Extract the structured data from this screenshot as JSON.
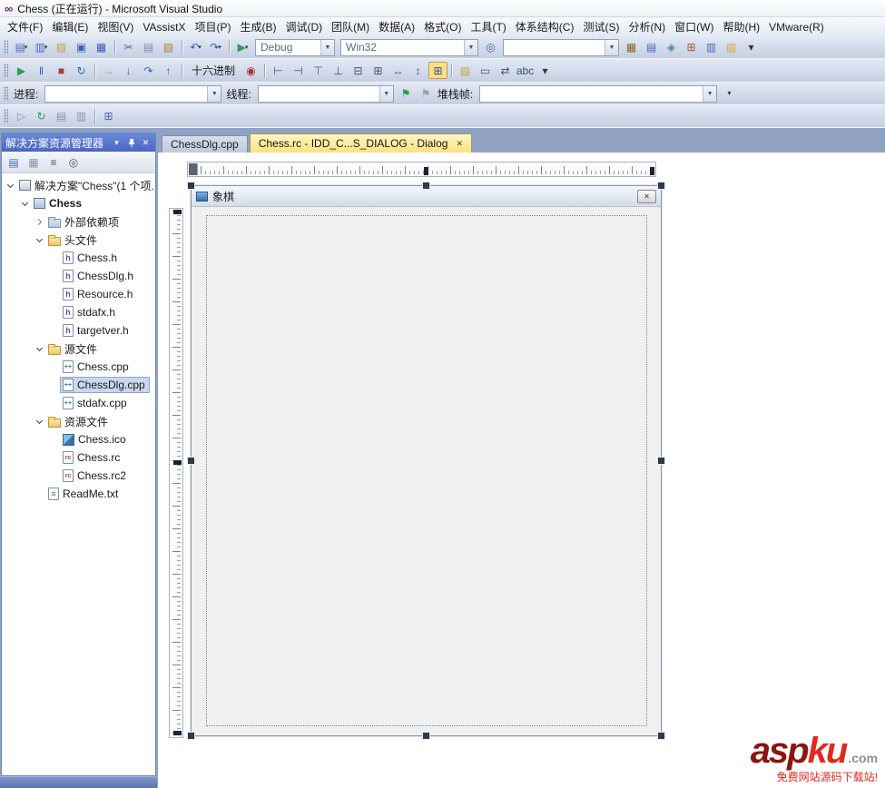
{
  "window": {
    "title": "Chess (正在运行) - Microsoft Visual Studio"
  },
  "menu": {
    "items": [
      "文件(F)",
      "编辑(E)",
      "视图(V)",
      "VAssistX",
      "项目(P)",
      "生成(B)",
      "调试(D)",
      "团队(M)",
      "数据(A)",
      "格式(O)",
      "工具(T)",
      "体系结构(C)",
      "测试(S)",
      "分析(N)",
      "窗口(W)",
      "帮助(H)",
      "VMware(R)"
    ]
  },
  "toolbar_standard": {
    "left_icons": [
      {
        "n": "new-project-icon",
        "g": "▤",
        "c": "#4a68b8",
        "caret": true
      },
      {
        "n": "add-item-icon",
        "g": "▥",
        "c": "#4a68b8",
        "caret": true
      },
      {
        "n": "open-file-icon",
        "g": "▨",
        "c": "#c9a23a"
      },
      {
        "n": "save-icon",
        "g": "▣",
        "c": "#3a62b8"
      },
      {
        "n": "save-all-icon",
        "g": "▦",
        "c": "#3a62b8"
      },
      {
        "sep": true
      },
      {
        "n": "cut-icon",
        "g": "✂",
        "c": "#5a6678"
      },
      {
        "n": "copy-icon",
        "g": "▤",
        "c": "#808ca0"
      },
      {
        "n": "paste-icon",
        "g": "▧",
        "c": "#b08030"
      },
      {
        "sep": true
      },
      {
        "n": "undo-icon",
        "g": "↶",
        "c": "#2f5bd0",
        "caret": true
      },
      {
        "n": "redo-icon",
        "g": "↷",
        "c": "#2f5bd0",
        "caret": true
      },
      {
        "sep": true
      },
      {
        "n": "start-debugging-icon",
        "g": "▶",
        "c": "#2e9e4f",
        "caret": true
      }
    ],
    "config_value": "Debug",
    "platform_value": "Win32",
    "mid_icons": [
      {
        "n": "find-in-files-icon",
        "g": "◎",
        "c": "#4a68b8"
      }
    ],
    "search_value": "",
    "right_icons": [
      {
        "n": "solution-explorer-icon",
        "g": "▦",
        "c": "#8a6a2a"
      },
      {
        "n": "properties-window-icon",
        "g": "▤",
        "c": "#4a68b8"
      },
      {
        "n": "object-browser-icon",
        "g": "◈",
        "c": "#3a8aa0"
      },
      {
        "n": "toolbox-icon",
        "g": "⊞",
        "c": "#a05a3a"
      },
      {
        "n": "command-window-icon",
        "g": "▥",
        "c": "#4a68b8"
      },
      {
        "n": "extension-icon",
        "g": "▨",
        "c": "#D8A838"
      },
      {
        "n": "toolbar-options-icon",
        "g": "▾",
        "c": "#333"
      }
    ]
  },
  "toolbar_debug": {
    "items": [
      {
        "n": "continue-icon",
        "g": "▶",
        "c": "#2e9e4f"
      },
      {
        "n": "break-all-icon",
        "g": "‖",
        "c": "#2e5ebf"
      },
      {
        "n": "stop-debugging-icon",
        "g": "■",
        "c": "#b03a3a"
      },
      {
        "n": "restart-icon",
        "g": "↻",
        "c": "#2e5ebf"
      },
      {
        "sep": true
      },
      {
        "n": "show-next-statement-icon",
        "g": "→",
        "c": "#c9a21a"
      },
      {
        "n": "step-into-icon",
        "g": "↓",
        "c": "#2e5ebf"
      },
      {
        "n": "step-over-icon",
        "g": "↷",
        "c": "#2e5ebf"
      },
      {
        "n": "step-out-icon",
        "g": "↑",
        "c": "#2e5ebf"
      },
      {
        "sep": true
      },
      {
        "btn": "十六进制",
        "n": "hex-display-button"
      },
      {
        "n": "breakpoints-window-icon",
        "g": "◉",
        "c": "#a33333"
      },
      {
        "sep": true
      },
      {
        "n": "align-lefts-icon",
        "g": "⊢",
        "c": "#4a5568"
      },
      {
        "n": "align-rights-icon",
        "g": "⊣",
        "c": "#4a5568"
      },
      {
        "n": "align-tops-icon",
        "g": "⊤",
        "c": "#4a5568"
      },
      {
        "n": "align-bottoms-icon",
        "g": "⊥",
        "c": "#4a5568"
      },
      {
        "n": "center-horizontal-icon",
        "g": "⊟",
        "c": "#4a5568"
      },
      {
        "n": "center-vertical-icon",
        "g": "⊞",
        "c": "#4a5568"
      },
      {
        "n": "make-same-width-icon",
        "g": "↔",
        "c": "#4a5568"
      },
      {
        "n": "make-same-height-icon",
        "g": "↕",
        "c": "#4a5568"
      },
      {
        "n": "toggle-grid-icon",
        "g": "⊞",
        "c": "#35507a",
        "hl": true
      },
      {
        "sep": true
      },
      {
        "n": "new-folder-icon",
        "g": "▨",
        "c": "#c9a23a"
      },
      {
        "n": "test-dialog-icon",
        "g": "▭",
        "c": "#4a5568"
      },
      {
        "n": "tab-order-icon",
        "g": "⇄",
        "c": "#4a5568"
      },
      {
        "n": "spell-check-icon",
        "g": "abc",
        "c": "#35507a"
      },
      {
        "n": "toolbar-options-icon",
        "g": "▾",
        "c": "#333"
      }
    ]
  },
  "debug_location": {
    "process_label": "进程:",
    "process_value": "",
    "thread_label": "线程:",
    "thread_value": "",
    "flags": [
      {
        "n": "show-threads-flag-icon",
        "g": "⚑",
        "c": "#2e9e4f"
      },
      {
        "n": "flag-threads-icon",
        "g": "⚑",
        "c": "#97a2b4"
      }
    ],
    "stack_label": "堆栈帧:",
    "stack_value": ""
  },
  "toolbar_misc": {
    "items": [
      {
        "n": "browse-forward-icon",
        "g": "▷",
        "c": "#8a94a8"
      },
      {
        "n": "refresh-icon",
        "g": "↻",
        "c": "#2e9e4f"
      },
      {
        "n": "copy-icon-2",
        "g": "▤",
        "c": "#8a94a8"
      },
      {
        "n": "pages-icon",
        "g": "▥",
        "c": "#8a94a8"
      },
      {
        "sep": true
      },
      {
        "n": "window-layout-icon",
        "g": "⊞",
        "c": "#4a68b8"
      }
    ]
  },
  "solution_explorer": {
    "title": "解决方案资源管理器",
    "toolbar_icons": [
      {
        "n": "properties-icon",
        "g": "▤",
        "c": "#4a68b8"
      },
      {
        "n": "show-all-files-icon",
        "g": "▦",
        "c": "#8a94a8"
      },
      {
        "n": "view-code-icon",
        "g": "≡",
        "c": "#4a5568"
      },
      {
        "n": "search-icon",
        "g": "◎",
        "c": "#4a5568"
      }
    ],
    "tree": [
      {
        "label": "解决方案\"Chess\"(1 个项...",
        "indent": 0,
        "icon": "solution",
        "arrow": "expanded"
      },
      {
        "label": "Chess",
        "indent": 1,
        "icon": "project",
        "arrow": "expanded",
        "bold": true
      },
      {
        "label": "外部依赖项",
        "indent": 2,
        "icon": "refs",
        "arrow": "collapsed"
      },
      {
        "label": "头文件",
        "indent": 2,
        "icon": "folder",
        "arrow": "expanded"
      },
      {
        "label": "Chess.h",
        "indent": 3,
        "icon": "header"
      },
      {
        "label": "ChessDlg.h",
        "indent": 3,
        "icon": "header"
      },
      {
        "label": "Resource.h",
        "indent": 3,
        "icon": "header"
      },
      {
        "label": "stdafx.h",
        "indent": 3,
        "icon": "header"
      },
      {
        "label": "targetver.h",
        "indent": 3,
        "icon": "header"
      },
      {
        "label": "源文件",
        "indent": 2,
        "icon": "folder",
        "arrow": "expanded"
      },
      {
        "label": "Chess.cpp",
        "indent": 3,
        "icon": "cpp"
      },
      {
        "label": "ChessDlg.cpp",
        "indent": 3,
        "icon": "cpp",
        "selected": true
      },
      {
        "label": "stdafx.cpp",
        "indent": 3,
        "icon": "cpp"
      },
      {
        "label": "资源文件",
        "indent": 2,
        "icon": "folder",
        "arrow": "expanded"
      },
      {
        "label": "Chess.ico",
        "indent": 3,
        "icon": "ico"
      },
      {
        "label": "Chess.rc",
        "indent": 3,
        "icon": "rc"
      },
      {
        "label": "Chess.rc2",
        "indent": 3,
        "icon": "rc"
      },
      {
        "label": "ReadMe.txt",
        "indent": 2,
        "icon": "txt"
      }
    ]
  },
  "editor": {
    "tabs": [
      {
        "label": "ChessDlg.cpp",
        "active": false,
        "closable": false
      },
      {
        "label": "Chess.rc - IDD_C...S_DIALOG - Dialog",
        "active": true,
        "closable": true
      }
    ]
  },
  "designer": {
    "dialog_title": "象棋"
  },
  "watermark": {
    "brand": "asp",
    "brand2": "ku",
    "tld": ".com",
    "tagline": "免费网站源码下载站!"
  },
  "colors": {
    "panel_header_blue": "#4A66C2",
    "active_tab_yellow": "#FFE27D",
    "selection_blue": "#C9D8EE",
    "watermark_red": "#E02A1E"
  }
}
